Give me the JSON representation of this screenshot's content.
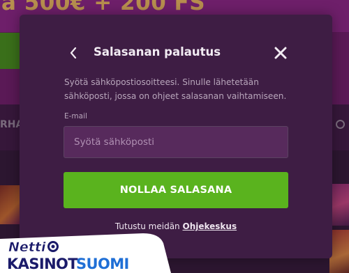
{
  "background": {
    "headline": "a 500€ + 200 FS",
    "nav_fragment": "RHA"
  },
  "modal": {
    "title": "Salasanan palautus",
    "back_icon": "chevron-left-icon",
    "close_icon": "close-icon",
    "intro": "Syötä sähköpostiosoitteesi. Sinulle lähetetään sähköposti, jossa on ohjeet salasanan vaihtamiseen.",
    "email_label": "E-mail",
    "email_placeholder": "Syötä sähköposti",
    "email_value": "",
    "submit_label": "NOLLAA SALASANA",
    "help_prefix": "Tutustu meidän",
    "help_link": "Ohjekeskus"
  },
  "watermark": {
    "line1": "Netti",
    "line2": "KASINOT",
    "line3": "SUOMI"
  },
  "colors": {
    "modal_bg": "#3e1d44",
    "accent_green": "#5ab31e",
    "input_bg": "#572a5c"
  }
}
